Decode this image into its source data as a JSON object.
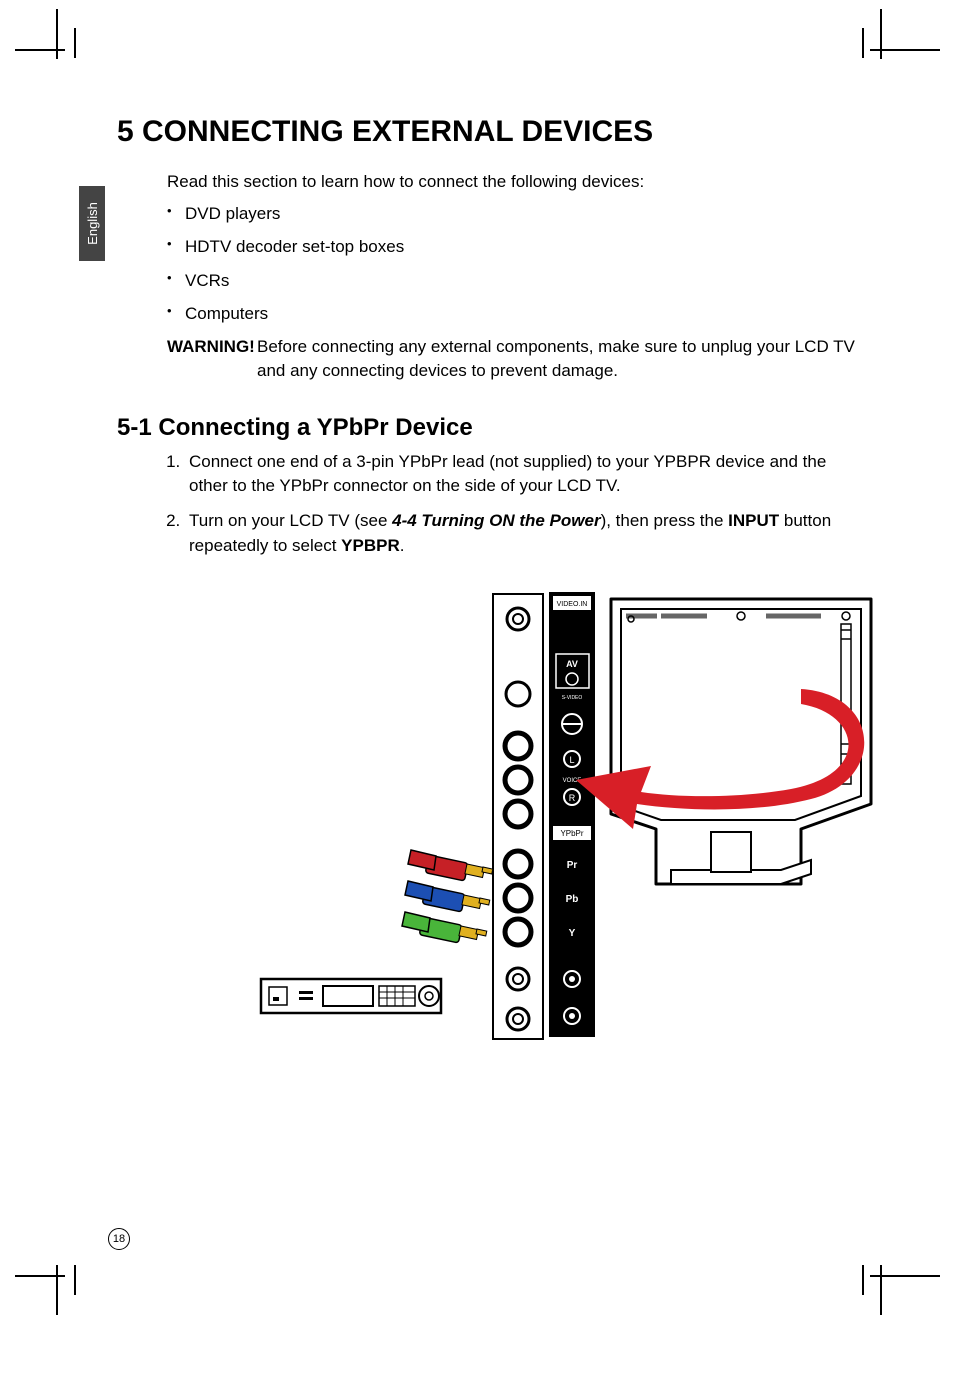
{
  "sideTab": {
    "label": "English"
  },
  "section": {
    "number": "5",
    "title": "5 CONNECTING EXTERNAL DEVICES"
  },
  "intro": {
    "lead": "Read this section to learn how to connect the following devices:",
    "items": [
      "DVD players",
      "HDTV decoder set-top boxes",
      "VCRs",
      "Computers"
    ]
  },
  "warning": {
    "label": "WARNING!",
    "text": "Before connecting any external components, make sure to unplug your LCD TV and any connecting devices to prevent damage."
  },
  "subsection": {
    "number": "5-1",
    "title": "5-1  Connecting a YPbPr Device"
  },
  "steps": {
    "s1": "Connect one end of a 3-pin YPbPr lead (not supplied) to your YPBPR device and the other to the YPbPr connector on the side of your LCD TV.",
    "s2pre": "Turn on your LCD TV (see ",
    "s2ref": "4-4 Turning ON the Power",
    "s2mid": "), then press the ",
    "s2btn": "INPUT",
    "s2mid2": " button repeatedly to select ",
    "s2sel": "YPBPR",
    "s2end": "."
  },
  "figure": {
    "tvPanelLabels": {
      "top": "VIDEO.IN",
      "av": "AV",
      "svideo": "S-VIDEO",
      "lAudio": "L",
      "rAudio": "R",
      "voice": "VOICE",
      "ypbpr": "YPbPr",
      "pr": "Pr",
      "pb": "Pb",
      "y": "Y"
    },
    "plugColors": {
      "pr": "#c62026",
      "pb": "#1c4fb3",
      "y": "#49b53a"
    },
    "arrowColor": "#d81f27"
  },
  "pageNumber": "18"
}
